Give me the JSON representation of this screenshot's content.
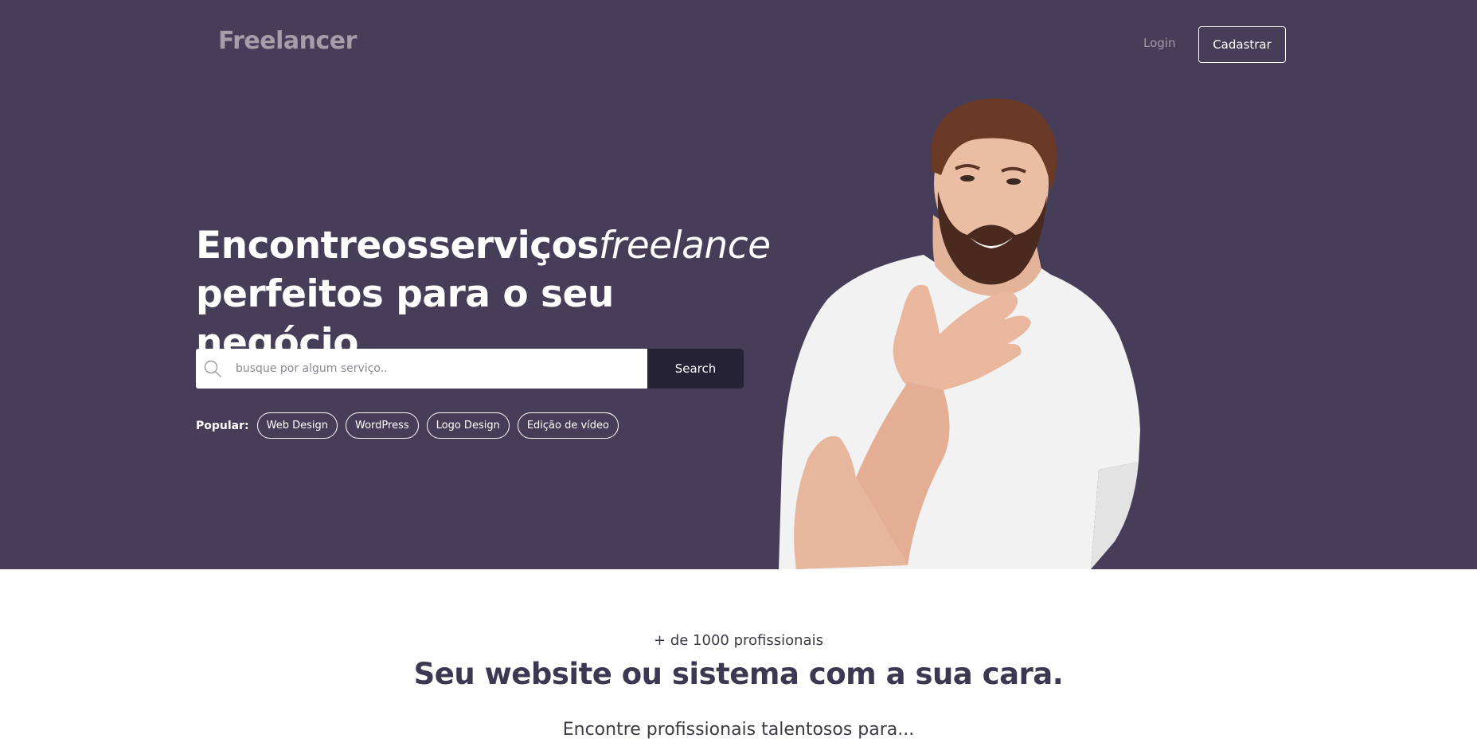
{
  "header": {
    "brand": "Freelancer",
    "login_label": "Login",
    "signup_label": "Cadastrar"
  },
  "hero": {
    "headline_words": [
      "Encontre",
      "os",
      "serviços"
    ],
    "headline_italic": "freelance",
    "headline_line2": "perfeitos para o seu negócio",
    "search": {
      "placeholder": "busque por algum serviço..",
      "value": "",
      "button_label": "Search"
    },
    "popular": {
      "label": "Popular:",
      "tags": [
        "Web Design",
        "WordPress",
        "Logo Design",
        "Edição de vídeo"
      ]
    },
    "photo_icon": "smiling-bearded-man-photo"
  },
  "section": {
    "kicker": "+ de 1000 profissionais",
    "title": "Seu website ou sistema com a sua cara.",
    "subtitle": "Encontre profissionais talentosos para..."
  },
  "colors": {
    "hero_bg": "#463d58",
    "search_button_bg": "#272336",
    "title_color": "#3d3851"
  }
}
